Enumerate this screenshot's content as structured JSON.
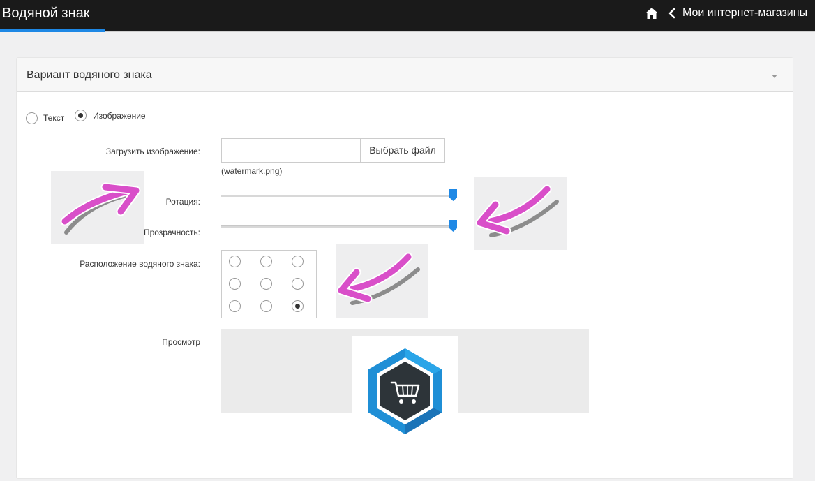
{
  "header": {
    "title": "Водяной знак",
    "back_label": "Мои интернет-магазины",
    "home_icon": "home-icon",
    "back_icon": "chevron-left-icon",
    "bg_color": "#1a1a1a",
    "accent_color": "#1e88e5"
  },
  "panel": {
    "title": "Вариант водяного знака",
    "collapse_icon": "caret-down-icon"
  },
  "watermark_type": {
    "options": [
      {
        "label": "Текст",
        "selected": false
      },
      {
        "label": "Изображение",
        "selected": true
      }
    ]
  },
  "form": {
    "upload_label": "Загрузить изображение:",
    "upload_button": "Выбрать файл",
    "file_name": "(watermark.png)",
    "rotation_label": "Ротация:",
    "rotation_value": 1.0,
    "opacity_label": "Прозрачность:",
    "opacity_value": 1.0,
    "position_label": "Расположение водяного знака:",
    "position_selected": "bottom-right",
    "preview_label": "Просмотр",
    "slider_color": "#1e88e5"
  },
  "annotations": {
    "arrow_color": "#d94fc9",
    "icon": "arrow-annotation-icon"
  },
  "preview": {
    "logo_icon": "shopping-cart-hexagon-icon",
    "logo_colors": [
      "#1f8fd6",
      "#2d3439"
    ]
  }
}
